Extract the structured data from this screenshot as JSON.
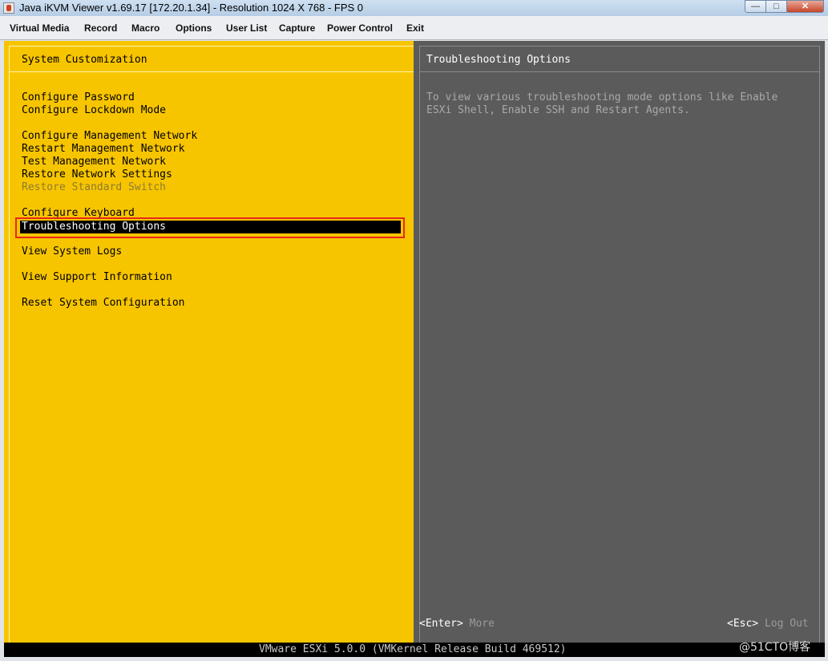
{
  "window": {
    "title": "Java iKVM Viewer v1.69.17 [172.20.1.34]  - Resolution 1024 X 768 - FPS 0",
    "controls": {
      "minimize": "—",
      "maximize": "□",
      "close": "✕"
    }
  },
  "menubar": {
    "items": [
      "Virtual Media",
      "Record",
      "Macro",
      "Options",
      "User List",
      "Capture",
      "Power Control",
      "Exit"
    ]
  },
  "console": {
    "left_header": "System Customization",
    "right_header": "Troubleshooting Options",
    "menu": [
      {
        "label": "Configure Password",
        "state": "normal"
      },
      {
        "label": "Configure Lockdown Mode",
        "state": "normal"
      },
      {
        "label": "Configure Management Network",
        "state": "normal"
      },
      {
        "label": "Restart Management Network",
        "state": "normal"
      },
      {
        "label": "Test Management Network",
        "state": "normal"
      },
      {
        "label": "Restore Network Settings",
        "state": "normal"
      },
      {
        "label": "Restore Standard Switch",
        "state": "disabled"
      },
      {
        "label": "Configure Keyboard",
        "state": "normal"
      },
      {
        "label": "Troubleshooting Options",
        "state": "selected"
      },
      {
        "label": "View System Logs",
        "state": "normal"
      },
      {
        "label": "View Support Information",
        "state": "normal"
      },
      {
        "label": "Reset System Configuration",
        "state": "normal"
      }
    ],
    "description": "To view various troubleshooting mode options like Enable\nESXi Shell, Enable SSH and Restart Agents.",
    "footer": {
      "enter_key": "<Enter>",
      "enter_action": "More",
      "esc_key": "<Esc>",
      "esc_action": "Log Out"
    },
    "status": "VMware ESXi 5.0.0 (VMKernel Release Build 469512)"
  },
  "watermark": "@51CTO博客",
  "colors": {
    "left_panel": "#f7c500",
    "right_panel": "#5b5b5b",
    "highlight_box": "#e8271c"
  }
}
